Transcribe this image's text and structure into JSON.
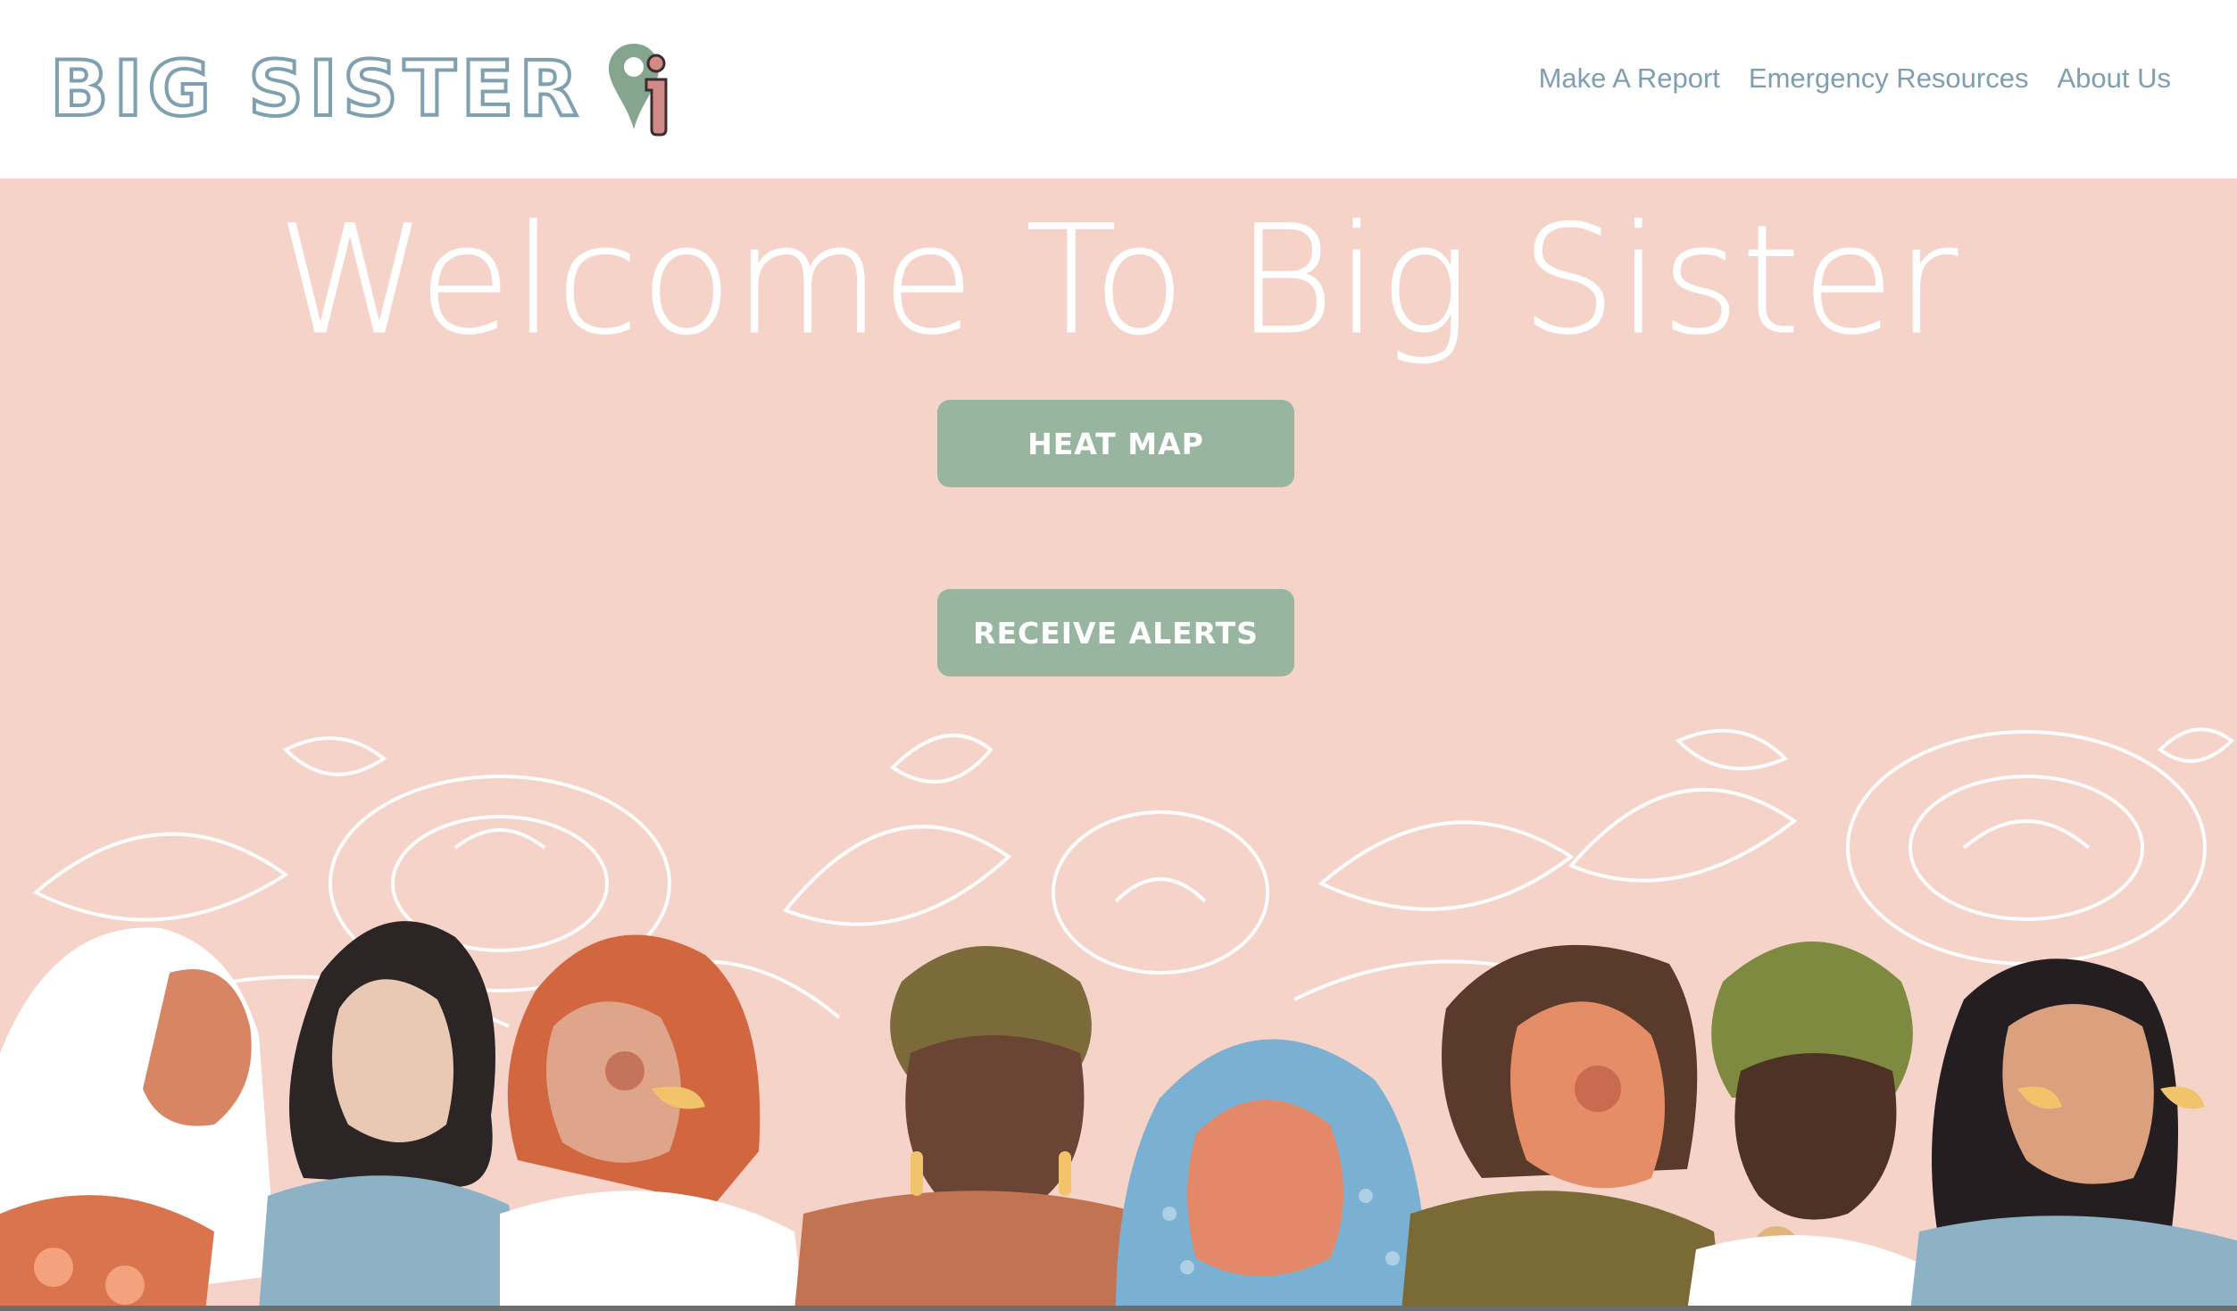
{
  "header": {
    "brand_name": "BIG SISTER",
    "brand_icon": "location-pin-person-icon",
    "nav": [
      {
        "label": "Make A Report"
      },
      {
        "label": "Emergency Resources"
      },
      {
        "label": "About Us"
      }
    ]
  },
  "hero": {
    "title": "Welcome To Big Sister",
    "buttons": {
      "heat_map": "HEAT MAP",
      "receive_alerts": "RECEIVE ALERTS"
    },
    "illustration": "floral-women-illustration"
  },
  "colors": {
    "header_bg": "#ffffff",
    "hero_bg": "#f5d3c9",
    "nav_text": "#7d9fb1",
    "brand_outline": "#7fa0ae",
    "button_bg": "#97b59f",
    "button_text": "#ffffff"
  }
}
